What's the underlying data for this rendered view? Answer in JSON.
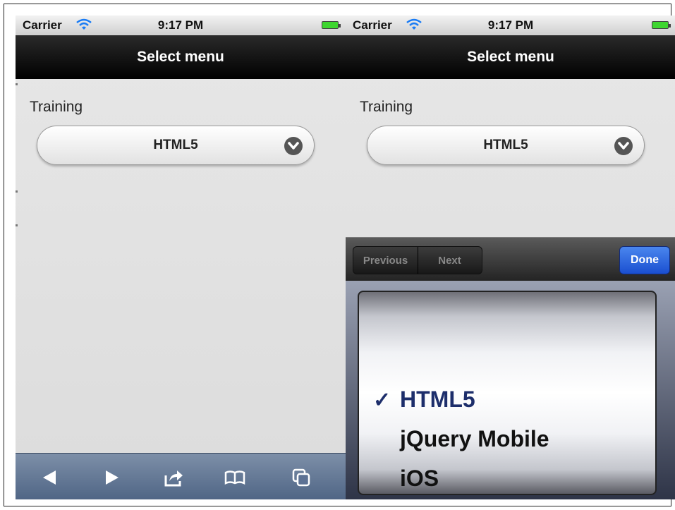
{
  "left_screen": {
    "status": {
      "carrier": "Carrier",
      "time": "9:17 PM"
    },
    "title": "Select menu",
    "field_label": "Training",
    "select_value": "HTML5",
    "toolbar_icons": [
      "back-icon",
      "forward-icon",
      "share-icon",
      "bookmarks-icon",
      "tabs-icon"
    ]
  },
  "right_screen": {
    "status": {
      "carrier": "Carrier",
      "time": "9:17 PM"
    },
    "title": "Select menu",
    "field_label": "Training",
    "select_value": "HTML5",
    "accessory": {
      "previous": "Previous",
      "next": "Next",
      "done": "Done"
    },
    "picker": {
      "check": "✓",
      "items": [
        "HTML5",
        "jQuery Mobile",
        "iOS"
      ],
      "selected": "HTML5"
    }
  }
}
